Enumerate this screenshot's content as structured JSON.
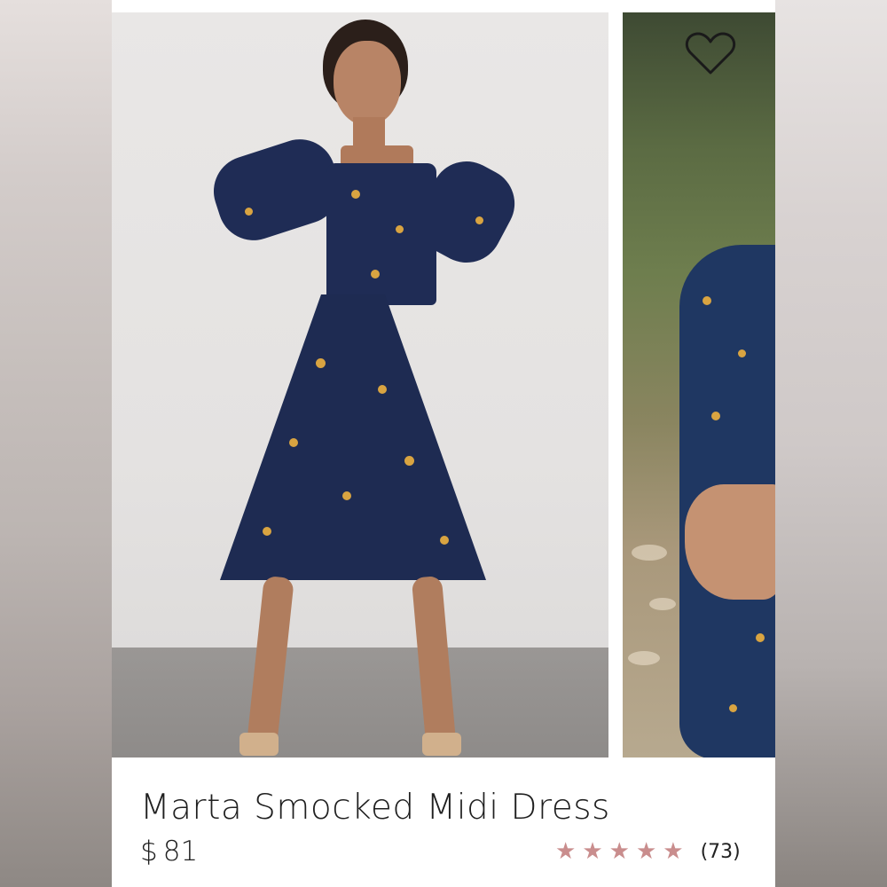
{
  "product": {
    "title": "Marta Smocked Midi Dress",
    "currency": "$",
    "price": "81",
    "rating": 5,
    "review_count": "(73)"
  },
  "icons": {
    "favorite": "heart-icon",
    "star": "star-icon",
    "star_glyph": "★"
  },
  "colors": {
    "star": "#c98d8d",
    "text": "#1f1f1f",
    "dress_navy": "#1f2c55",
    "floral_gold": "#d9a441"
  }
}
